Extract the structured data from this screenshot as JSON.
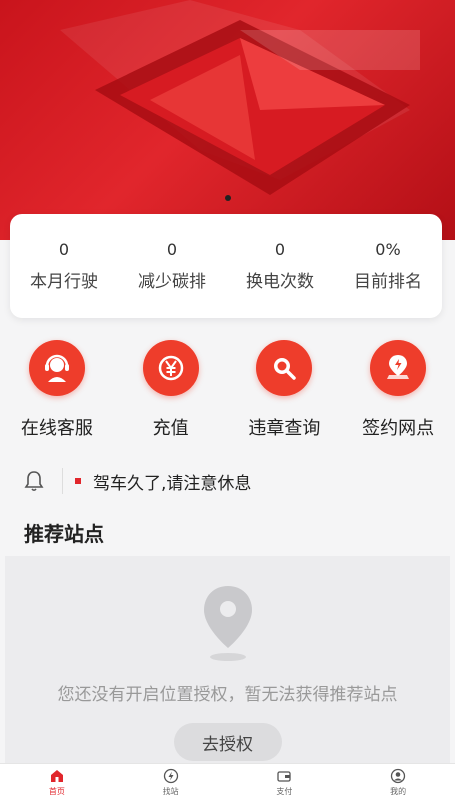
{
  "banner": {
    "dots": 1
  },
  "stats": [
    {
      "value": "0",
      "label": "本月行驶"
    },
    {
      "value": "0",
      "label": "减少碳排"
    },
    {
      "value": "0",
      "label": "换电次数"
    },
    {
      "value": "0%",
      "label": "目前排名"
    }
  ],
  "actions": [
    {
      "label": "在线客服",
      "icon": "customer-service-icon"
    },
    {
      "label": "充值",
      "icon": "yuan-icon"
    },
    {
      "label": "违章查询",
      "icon": "search-icon"
    },
    {
      "label": "签约网点",
      "icon": "map-pin-icon"
    }
  ],
  "notice": {
    "text": "驾车久了,请注意休息"
  },
  "section": {
    "title": "推荐站点"
  },
  "empty_state": {
    "message": "您还没有开启位置授权，暂无法获得推荐站点",
    "button_label": "去授权"
  },
  "tabbar": [
    {
      "label": "首页",
      "icon": "home-icon",
      "active": true
    },
    {
      "label": "找站",
      "icon": "lightning-icon",
      "active": false
    },
    {
      "label": "支付",
      "icon": "wallet-icon",
      "active": false
    },
    {
      "label": "我的",
      "icon": "user-icon",
      "active": false
    }
  ],
  "colors": {
    "brand_red": "#e1262c",
    "accent_orange_red": "#ee3d2b"
  }
}
